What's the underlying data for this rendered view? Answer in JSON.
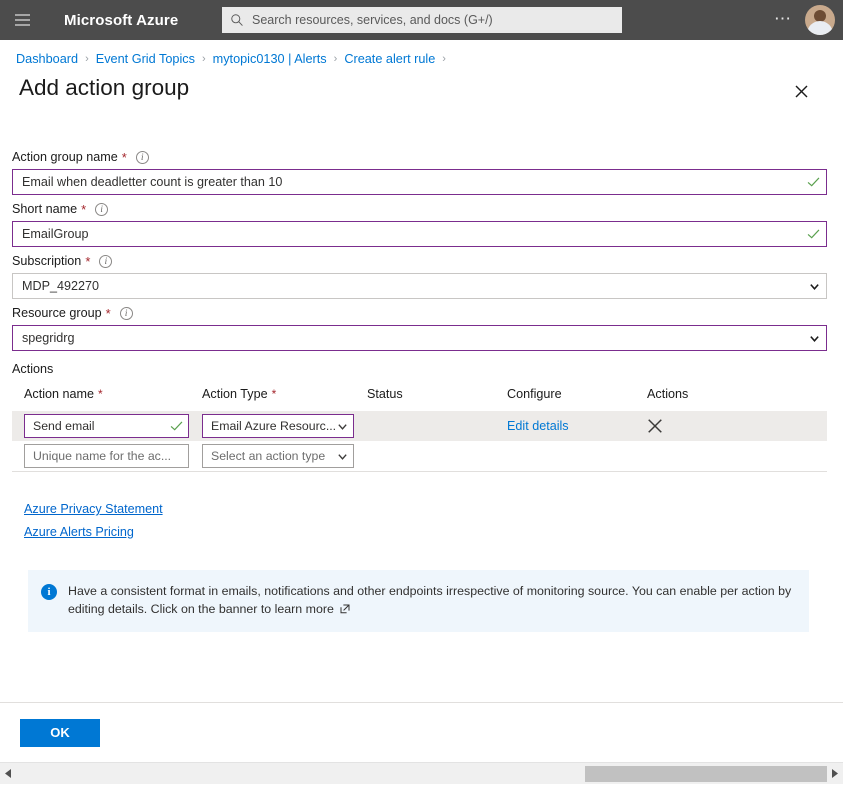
{
  "topbar": {
    "menu_icon": "hamburger-icon",
    "brand": "Microsoft Azure",
    "search_placeholder": "Search resources, services, and docs (G+/)",
    "search_icon": "search-icon",
    "more_icon": "ellipsis-icon",
    "avatar": "user-avatar"
  },
  "breadcrumb": {
    "items": [
      {
        "label": "Dashboard"
      },
      {
        "label": "Event Grid Topics"
      },
      {
        "label": "mytopic0130 | Alerts"
      },
      {
        "label": "Create alert rule"
      }
    ],
    "separator": "›"
  },
  "page": {
    "title": "Add action group",
    "close_icon": "close-icon"
  },
  "form": {
    "fields": [
      {
        "label": "Action group name",
        "required": "*",
        "info_icon": "info-icon",
        "value": "Email when deadletter count is greater than 10",
        "state": "validated",
        "indicator": "check-icon"
      },
      {
        "label": "Short name",
        "required": "*",
        "info_icon": "info-icon",
        "value": "EmailGroup",
        "state": "validated",
        "indicator": "check-icon"
      },
      {
        "label": "Subscription",
        "required": "*",
        "info_icon": "info-icon",
        "value": "MDP_492270",
        "state": "plain",
        "indicator": "chevron-down-icon"
      },
      {
        "label": "Resource group",
        "required": "*",
        "info_icon": "info-icon",
        "value": "spegridrg",
        "state": "validated",
        "indicator": "chevron-down-icon"
      }
    ]
  },
  "actions": {
    "section_label": "Actions",
    "columns": [
      {
        "label": "Action name",
        "required": "*"
      },
      {
        "label": "Action Type",
        "required": "*"
      },
      {
        "label": "Status",
        "required": ""
      },
      {
        "label": "Configure",
        "required": ""
      },
      {
        "label": "Actions",
        "required": ""
      }
    ],
    "rows": [
      {
        "name_value": "Send email",
        "name_state": "validated",
        "name_indicator": "check-icon",
        "type_value": "Email Azure Resourc...",
        "type_state": "validated",
        "type_indicator": "chevron-down-icon",
        "status": "",
        "configure_label": "Edit details",
        "delete_icon": "close-icon"
      },
      {
        "name_placeholder": "Unique name for the ac...",
        "name_state": "plain",
        "type_placeholder": "Select an action type",
        "type_state": "plain",
        "type_indicator": "chevron-down-icon",
        "status": "",
        "configure_label": "",
        "delete_icon": ""
      }
    ]
  },
  "links": [
    {
      "label": "Azure Privacy Statement"
    },
    {
      "label": "Azure Alerts Pricing"
    }
  ],
  "banner": {
    "icon": "info-filled-icon",
    "text": "Have a consistent format in emails, notifications and other endpoints irrespective of monitoring source. You can enable per action by editing details. Click on the banner to learn more",
    "external_icon": "external-link-icon"
  },
  "footer": {
    "ok_label": "OK"
  },
  "scrollbar": {
    "left_arrow": "arrow-left-icon",
    "right_arrow": "arrow-right-icon"
  },
  "colors": {
    "topbar_bg": "#4c4c4c",
    "accent": "#0078d4",
    "validated_border": "#7b2d8e",
    "required_star": "#a4262c",
    "banner_bg": "#eff6fc",
    "row_highlight": "#edebe9",
    "check_green": "#5aa04e"
  }
}
